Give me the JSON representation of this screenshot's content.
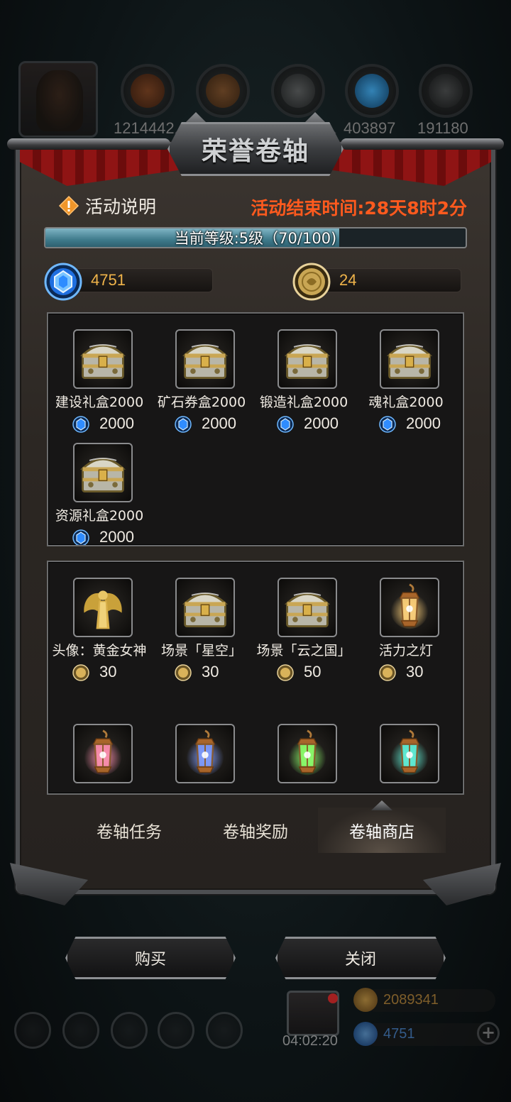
{
  "background": {
    "resource_counts": [
      "1214442",
      "403897",
      "191180"
    ],
    "hud": {
      "gold": "2089341",
      "gems": "4751",
      "timer": "04:02:20"
    }
  },
  "panel": {
    "title": "荣誉卷轴",
    "info_label": "活动说明",
    "end_time": "活动结束时间:28天8时2分",
    "level_text": "当前等级:5级（70/100)",
    "level_progress": 0.7,
    "gems": "4751",
    "coins": "24"
  },
  "box1": {
    "items": [
      {
        "name": "建设礼盒2000",
        "price": "2000",
        "currency": "gem",
        "icon": "chest-icon"
      },
      {
        "name": "矿石券盒2000",
        "price": "2000",
        "currency": "gem",
        "icon": "chest-icon"
      },
      {
        "name": "锻造礼盒2000",
        "price": "2000",
        "currency": "gem",
        "icon": "chest-icon"
      },
      {
        "name": "魂礼盒2000",
        "price": "2000",
        "currency": "gem",
        "icon": "chest-icon"
      },
      {
        "name": "资源礼盒2000",
        "price": "2000",
        "currency": "gem",
        "icon": "chest-icon"
      }
    ]
  },
  "box2": {
    "items": [
      {
        "name": "头像：黄金女神",
        "price": "30",
        "currency": "coin",
        "icon": "golden-goddess-icon"
      },
      {
        "name": "场景「星空」",
        "price": "30",
        "currency": "coin",
        "icon": "chest-icon"
      },
      {
        "name": "场景「云之国」",
        "price": "50",
        "currency": "coin",
        "icon": "chest-icon"
      },
      {
        "name": "活力之灯",
        "price": "30",
        "currency": "coin",
        "icon": "lantern-icon"
      }
    ],
    "lanterns": [
      {
        "color": "#ff8fb0",
        "icon": "pink-lantern-icon"
      },
      {
        "color": "#7f9cff",
        "icon": "blue-lantern-icon"
      },
      {
        "color": "#8cff6a",
        "icon": "green-lantern-icon"
      },
      {
        "color": "#5ff0d8",
        "icon": "cyan-lantern-icon"
      }
    ]
  },
  "tabs": [
    "卷轴任务",
    "卷轴奖励",
    "卷轴商店"
  ],
  "buttons": {
    "buy": "购买",
    "close": "关闭"
  },
  "colors": {
    "end_time": "#ff5a1e",
    "currency_value": "#f0b44a",
    "gem_blue": "#2f8cff",
    "coin_gold": "#d9b25a"
  }
}
